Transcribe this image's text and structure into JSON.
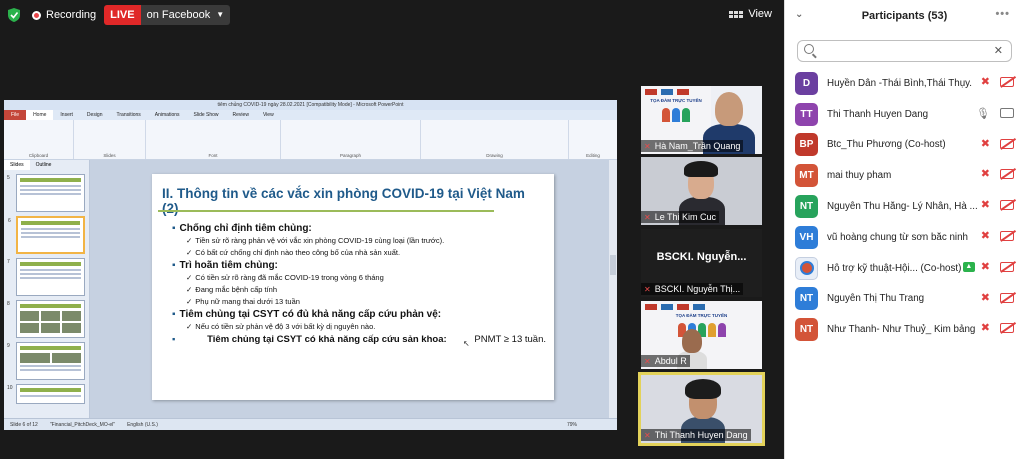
{
  "topbar": {
    "recording_label": "Recording",
    "live_label": "LIVE",
    "live_target": "on Facebook",
    "view_label": "View"
  },
  "ppt": {
    "window_title": "tiêm chủng COVID-19 ngày 28.02.2021 [Compatibility Mode] - Microsoft PowerPoint",
    "tabs": [
      "File",
      "Home",
      "Insert",
      "Design",
      "Transitions",
      "Animations",
      "Slide Show",
      "Review",
      "View"
    ],
    "groups": [
      "Clipboard",
      "Slides",
      "Font",
      "Paragraph",
      "Drawing",
      "Editing"
    ],
    "thumb_tabs": [
      "Slides",
      "Outline"
    ],
    "thumb_numbers": [
      "5",
      "6",
      "7",
      "8",
      "9",
      "10"
    ],
    "status": [
      "Slide 6 of 12",
      "\"Financial_PitchDeck_MO-el\"",
      "English (U.S.)"
    ],
    "zoom": "79%"
  },
  "slide": {
    "title": "II. Thông tin về các vắc xin phòng COVID-19 tại Việt Nam (2)",
    "sections": [
      {
        "heading": "Chống chỉ định tiêm chủng:",
        "items": [
          "Tiền sử rõ ràng phản vệ với vắc xin phòng COVID-19 cùng loại (lần trước).",
          "Có bất cứ chống chỉ định nào theo công bố của nhà sản xuất."
        ]
      },
      {
        "heading": "Trì hoãn tiêm chủng:",
        "items": [
          "Có tiền sử rõ ràng đã mắc COVID-19 trong vòng 6 tháng",
          "Đang mắc bệnh cấp tính",
          "Phụ nữ mang thai dưới 13 tuần"
        ]
      },
      {
        "heading": "Tiêm chủng tại CSYT có đủ khả năng cấp cứu phản vệ:",
        "items": [
          "Nếu có tiền sử phản vệ độ 3 với bất kỳ dị nguyên nào."
        ]
      }
    ],
    "last_line": "Tiêm chủng tại CSYT có khả năng cấp cứu sản khoa:",
    "last_value": "PNMT ≥ 13 tuần."
  },
  "videos": [
    {
      "name": "Hà Nam_Trần Quang"
    },
    {
      "name": "Le Thi Kim Cuc"
    },
    {
      "name": "BSCKI. Nguyễn Thị...",
      "overlay": "BSCKI.  Nguyễn..."
    },
    {
      "name": "Abdul R"
    },
    {
      "name": "Thi Thanh Huyen Dang"
    }
  ],
  "banner_text": "TỌA ĐÀM TRỰC TUYẾN",
  "participants": {
    "title": "Participants (53)",
    "list": [
      {
        "initials": "D",
        "name": "Huyền Dân -Thái Bình,Thái Thụy.",
        "color": "#6b3fa0",
        "mic": "off",
        "cam": "off"
      },
      {
        "initials": "TT",
        "name": "Thi Thanh Huyen Dang",
        "color": "#8e44ad",
        "mic": "on",
        "cam": "on"
      },
      {
        "initials": "BP",
        "name": "Btc_Thu Phương (Co-host)",
        "color": "#c0392b",
        "mic": "off",
        "cam": "off"
      },
      {
        "initials": "MT",
        "name": "mai thuy pham",
        "color": "#d35438",
        "mic": "off",
        "cam": "off"
      },
      {
        "initials": "NT",
        "name": "Nguyễn Thu Hằng- Lý Nhân, Hà ...",
        "color": "#27a35c",
        "mic": "off",
        "cam": "off"
      },
      {
        "initials": "VH",
        "name": "vũ hoàng chung  từ sơn  bắc ninh",
        "color": "#2e7dd8",
        "mic": "off",
        "cam": "off"
      },
      {
        "initials": "",
        "name": "Hỗ trợ kỹ thuật-Hội... (Co-host)",
        "color": "#e8eef7",
        "mic": "off",
        "cam": "off",
        "share": true
      },
      {
        "initials": "NT",
        "name": "Nguyễn Thị Thu Trang",
        "color": "#2e7dd8",
        "mic": "off",
        "cam": "off"
      },
      {
        "initials": "NT",
        "name": "Như Thanh- Như Thuỷ_ Kim bảng",
        "color": "#d35438",
        "mic": "off",
        "cam": "off"
      }
    ]
  }
}
